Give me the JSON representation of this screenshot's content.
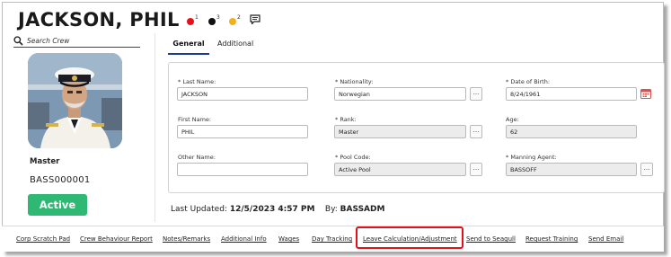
{
  "header": {
    "crew_name": "JACKSON, PHIL",
    "indicators": [
      {
        "color": "#e8101d",
        "count": "1"
      },
      {
        "color": "#111111",
        "count": "3"
      },
      {
        "color": "#f2b01e",
        "count": "2"
      }
    ],
    "chat_icon": "speech-bubble-icon"
  },
  "search": {
    "placeholder": "Search Crew"
  },
  "profile": {
    "rank": "Master",
    "crew_id": "BASS000001",
    "status": "Active",
    "status_color": "#2eb873"
  },
  "tabs": [
    {
      "label": "General",
      "active": true
    },
    {
      "label": "Additional",
      "active": false
    }
  ],
  "form": {
    "last_name": {
      "label": "* Last Name:",
      "value": "JACKSON"
    },
    "first_name": {
      "label": "First Name:",
      "value": "PHIL"
    },
    "other_name": {
      "label": "Other Name:",
      "value": ""
    },
    "nationality": {
      "label": "* Nationality:",
      "value": "Norwegian"
    },
    "rank": {
      "label": "* Rank:",
      "value": "Master"
    },
    "pool_code": {
      "label": "* Pool Code:",
      "value": "Active Pool"
    },
    "date_of_birth": {
      "label": "* Date of Birth:",
      "value": "8/24/1961"
    },
    "age": {
      "label": "Age:",
      "value": "62"
    },
    "manning_agent": {
      "label": "* Manning Agent:",
      "value": "BASSOFF"
    },
    "lookup_label": "..."
  },
  "audit": {
    "last_updated_label": "Last Updated:",
    "last_updated_value": "12/5/2023 4:57 PM",
    "by_label": "By:",
    "by_value": "BASSADM"
  },
  "footer_links": [
    "Corp Scratch Pad",
    "Crew Behaviour Report",
    "Notes/Remarks",
    "Additional Info",
    "Wages",
    "Day Tracking",
    "Leave Calculation/Adjustment",
    "Send to Seagull",
    "Request Training",
    "Send Email"
  ],
  "highlight_color": "#e0131a"
}
